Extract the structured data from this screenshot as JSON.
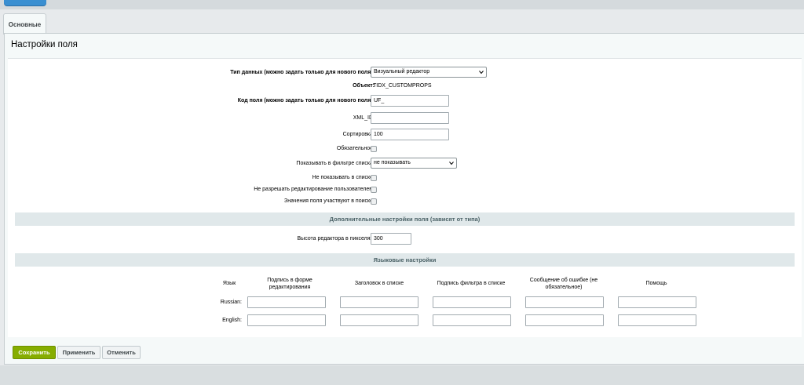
{
  "tabs": [
    "Основные"
  ],
  "panel_title": "Настройки поля",
  "fields": {
    "data_type_label": "Тип данных (можно задать только для нового поля):",
    "data_type_value": "Визуальный редактор",
    "object_label": "Объект:",
    "object_value": "TIDX_CUSTOMPROPS",
    "code_label": "Код поля (можно задать только для нового поля):",
    "code_value": "UF_",
    "xml_id_label": "XML_ID:",
    "xml_id_value": "",
    "sort_label": "Сортировка:",
    "sort_value": "100",
    "required_label": "Обязательное:",
    "filter_label": "Показывать в фильтре списка:",
    "filter_value": "не показывать",
    "hide_in_list_label": "Не показывать в списке:",
    "no_edit_label": "Не разрешать редактирование пользователем:",
    "search_label": "Значения поля участвуют в поиске:"
  },
  "extra_section": {
    "title": "Дополнительные настройки поля (зависят от типа)",
    "height_label": "Высота редактора в пикселях:",
    "height_value": "300"
  },
  "lang_section": {
    "title": "Языковые настройки",
    "headers": [
      "Язык",
      "Подпись в форме редактирования",
      "Заголовок в списке",
      "Подпись фильтра в списке",
      "Сообщение об ошибке (не обязательное)",
      "Помощь"
    ],
    "rows": [
      "Russian:",
      "English:"
    ]
  },
  "buttons": {
    "save": "Сохранить",
    "apply": "Применить",
    "cancel": "Отменить"
  },
  "colors": {
    "save_button": "#86ad00",
    "section_bg": "#e0e8ea",
    "top_button": "#3a8fd1"
  }
}
